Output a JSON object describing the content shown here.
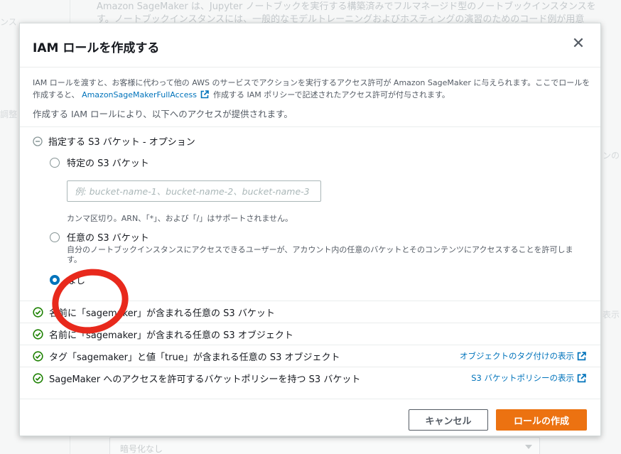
{
  "background": {
    "line1": "Amazon SageMaker は、Jupyter ノートブックを実行する構築済みでフルマネージド型のノートブックインスタンスを",
    "line2": "す。ノートブックインスタンスには、一般的なモデルトレーニングおよびホスティングの演習のためのコード例が用意",
    "side_left_1": "ンス",
    "side_left_2": "調整",
    "side_right_1": "ンの",
    "side_right_2": "表示",
    "encryption_select": "暗号化なし"
  },
  "modal": {
    "title": "IAM ロールを作成する",
    "close_glyph": "✕",
    "description_part1": "IAM ロールを渡すと、お客様に代わって他の AWS のサービスでアクションを実行するアクセス許可が Amazon SageMaker に与えられます。ここでロールを作成すると、",
    "description_link": "AmazonSageMakerFullAccess",
    "description_part2": "作成する IAM ポリシーで記述されたアクセス許可が付与されます。",
    "access_intro": "作成する IAM ロールにより、以下へのアクセスが提供されます。",
    "s3_section": {
      "heading": "指定する S3 バケット - オプション",
      "options": [
        {
          "label": "特定の S3 バケット",
          "checked": false
        },
        {
          "label": "任意の S3 バケット",
          "checked": false
        },
        {
          "label": "なし",
          "checked": true
        }
      ],
      "bucket_placeholder": "例: bucket-name-1、bucket-name-2、bucket-name-3",
      "bucket_hint": "カンマ区切り。ARN、「*」、および「/」はサポートされません。",
      "any_bucket_desc": "自分のノートブックインスタンスにアクセスできるユーザーが、アカウント内の任意のバケットとそのコンテンツにアクセスすることを許可します。"
    },
    "permissions": [
      {
        "label": "名前に「sagemaker」が含まれる任意の S3 バケット",
        "link": ""
      },
      {
        "label": "名前に「sagemaker」が含まれる任意の S3 オブジェクト",
        "link": ""
      },
      {
        "label": "タグ「sagemaker」と値「true」が含まれる任意の S3 オブジェクト",
        "link": "オブジェクトのタグ付けの表示"
      },
      {
        "label": "SageMaker へのアクセスを許可するバケットポリシーを持つ S3 バケット",
        "link": "S3 バケットポリシーの表示"
      }
    ],
    "cancel_label": "キャンセル",
    "create_label": "ロールの作成"
  },
  "colors": {
    "link": "#0073bb",
    "primary": "#ec7211",
    "success": "#1d8102",
    "highlight": "#e8291c"
  }
}
